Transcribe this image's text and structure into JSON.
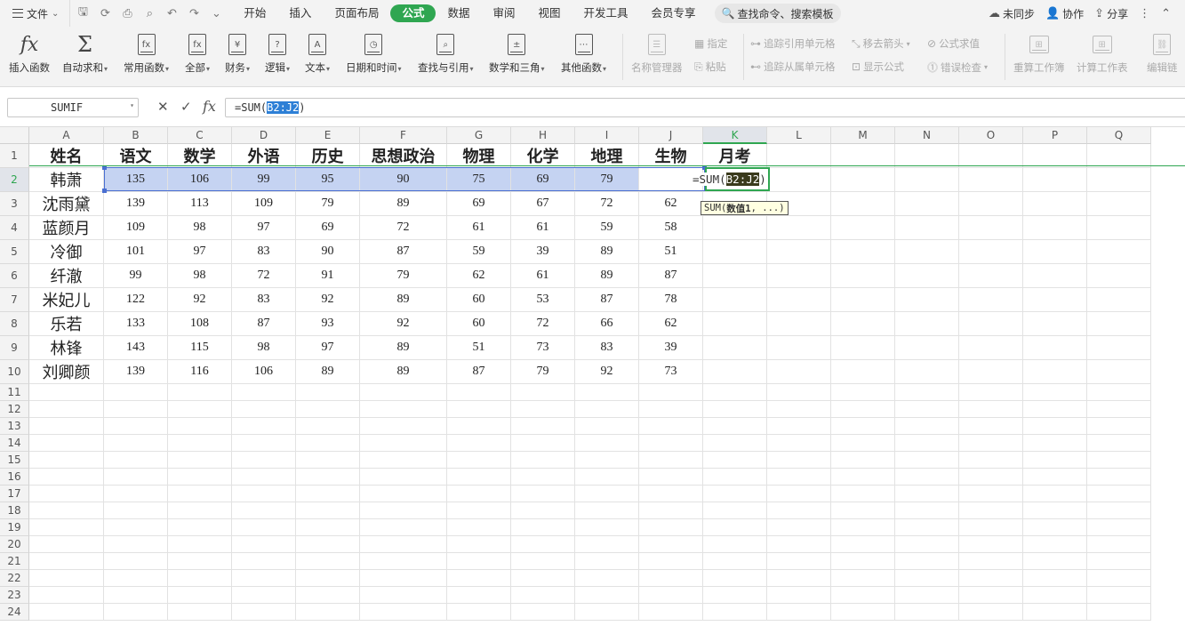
{
  "menubar": {
    "file_label": "文件",
    "tabs": [
      "开始",
      "插入",
      "页面布局",
      "公式",
      "数据",
      "审阅",
      "视图",
      "开发工具",
      "会员专享"
    ],
    "active_tab": "公式",
    "search_label": "查找命令、搜索模板",
    "right": {
      "sync": "未同步",
      "collab": "协作",
      "share": "分享"
    }
  },
  "ribbon": {
    "insert_func": "插入函数",
    "autosum": "自动求和",
    "common": "常用函数",
    "all": "全部",
    "finance": "财务",
    "logic": "逻辑",
    "text": "文本",
    "datetime": "日期和时间",
    "lookup": "查找与引用",
    "math": "数学和三角",
    "other": "其他函数",
    "name_mgr": "名称管理器",
    "assign": "指定",
    "paste": "粘贴",
    "trace_prec": "追踪引用单元格",
    "trace_dep": "追踪从属单元格",
    "remove_arrows": "移去箭头",
    "show_formula": "显示公式",
    "eval_formula": "公式求值",
    "error_check": "错误检查",
    "recalc_book": "重算工作簿",
    "calc_sheet": "计算工作表",
    "edit_link": "编辑链"
  },
  "formula_bar": {
    "name_box": "SUMIF",
    "formula_prefix": "=SUM(",
    "formula_range": "B2:J2",
    "formula_suffix": ")"
  },
  "sheet": {
    "columns": [
      "A",
      "B",
      "C",
      "D",
      "E",
      "F",
      "G",
      "H",
      "I",
      "J",
      "K",
      "L",
      "M",
      "N",
      "O",
      "P",
      "Q"
    ],
    "row_numbers": [
      "1",
      "2",
      "3",
      "4",
      "5",
      "6",
      "7",
      "8",
      "9",
      "10",
      "11",
      "12",
      "13",
      "14",
      "15",
      "16",
      "17",
      "18",
      "19",
      "20",
      "21",
      "22",
      "23",
      "24"
    ],
    "headers": [
      "姓名",
      "语文",
      "数学",
      "外语",
      "历史",
      "思想政治",
      "物理",
      "化学",
      "地理",
      "生物",
      "月考"
    ],
    "rows": [
      [
        "韩萧",
        "135",
        "106",
        "99",
        "95",
        "90",
        "75",
        "69",
        "79",
        ""
      ],
      [
        "沈雨黛",
        "139",
        "113",
        "109",
        "79",
        "89",
        "69",
        "67",
        "72",
        "62"
      ],
      [
        "蓝颜月",
        "109",
        "98",
        "97",
        "69",
        "72",
        "61",
        "61",
        "59",
        "58"
      ],
      [
        "冷御",
        "101",
        "97",
        "83",
        "90",
        "87",
        "59",
        "39",
        "89",
        "51"
      ],
      [
        "纤澈",
        "99",
        "98",
        "72",
        "91",
        "79",
        "62",
        "61",
        "89",
        "87"
      ],
      [
        "米妃儿",
        "122",
        "92",
        "83",
        "92",
        "89",
        "60",
        "53",
        "87",
        "78"
      ],
      [
        "乐若",
        "133",
        "108",
        "87",
        "93",
        "92",
        "60",
        "72",
        "66",
        "62"
      ],
      [
        "林锋",
        "143",
        "115",
        "98",
        "97",
        "89",
        "51",
        "73",
        "83",
        "39"
      ],
      [
        "刘卿颜",
        "139",
        "116",
        "106",
        "89",
        "89",
        "87",
        "79",
        "92",
        "73"
      ]
    ],
    "active_cell": {
      "prefix": "=SUM(",
      "range": "B2:J2",
      "suffix": ")"
    },
    "tooltip": {
      "func": "SUM",
      "args_open": "(",
      "arg_bold": "数值1",
      "args_rest": ", ...)"
    }
  }
}
